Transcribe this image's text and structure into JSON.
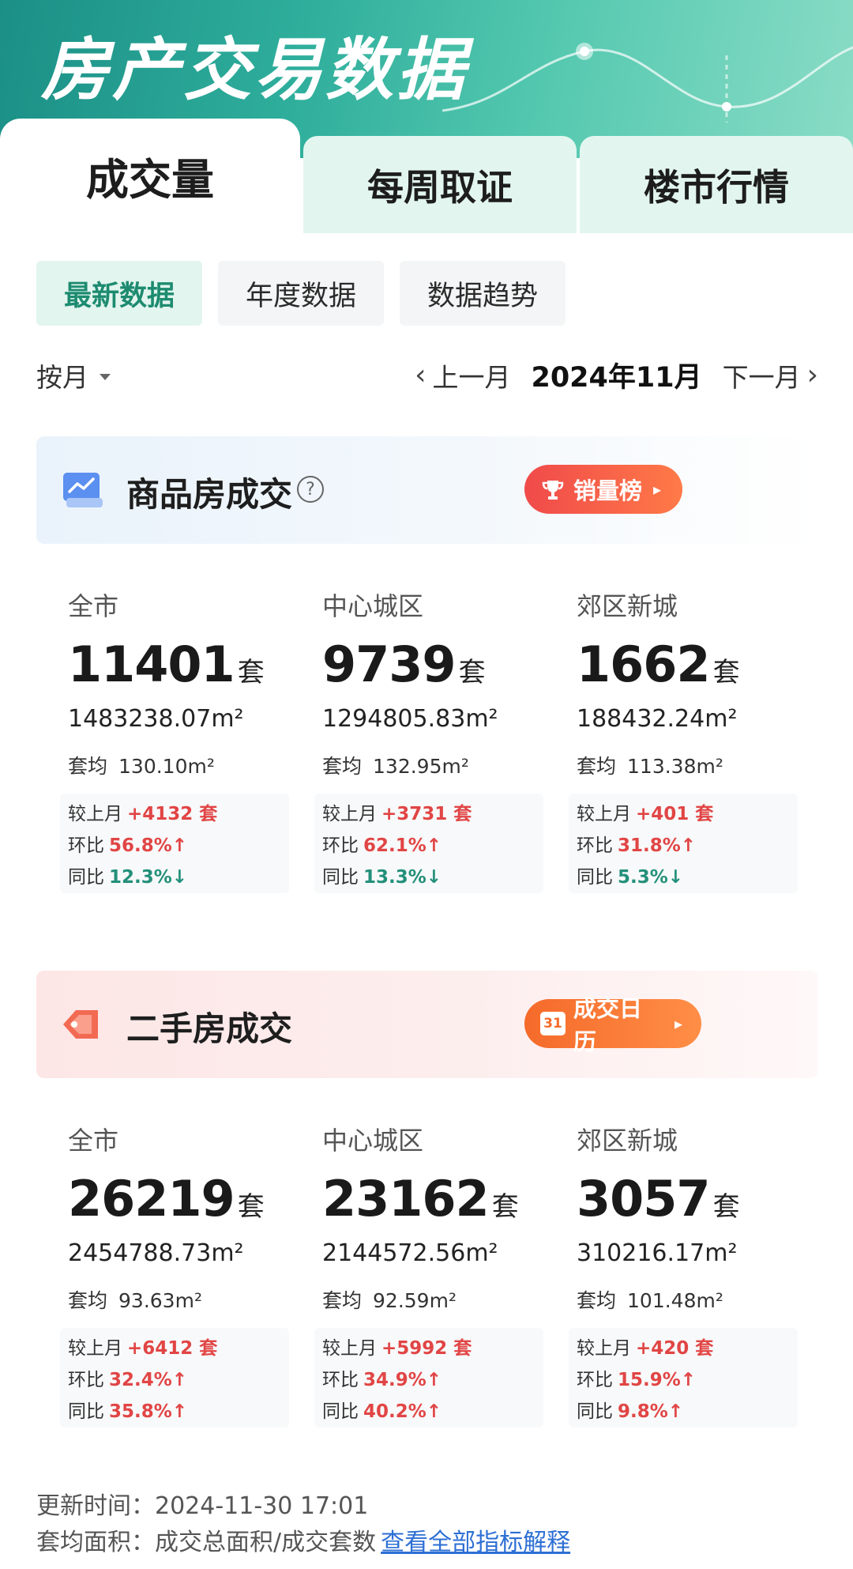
{
  "banner": {
    "title": "房产交易数据"
  },
  "main_tabs": [
    "成交量",
    "每周取证",
    "楼市行情"
  ],
  "sub_tabs": [
    "最新数据",
    "年度数据",
    "数据趋势"
  ],
  "month_bar": {
    "period": "按月",
    "prev_label": "上一月",
    "current_month": "2024年11月",
    "next_label": "下一月"
  },
  "new_homes": {
    "title": "商品房成交",
    "button_label": "销量榜",
    "columns": [
      {
        "region": "全市",
        "units": "11401",
        "unit_suffix": "套",
        "area": "1483238.07m²",
        "avg_key": "套均",
        "avg_value": "130.10m²",
        "mom_diff_key": "较上月",
        "mom_diff": "+4132 套",
        "mom_key": "环比",
        "mom": "56.8%↑",
        "yoy_key": "同比",
        "yoy": "12.3%↓"
      },
      {
        "region": "中心城区",
        "units": "9739",
        "unit_suffix": "套",
        "area": "1294805.83m²",
        "avg_key": "套均",
        "avg_value": "132.95m²",
        "mom_diff_key": "较上月",
        "mom_diff": "+3731 套",
        "mom_key": "环比",
        "mom": "62.1%↑",
        "yoy_key": "同比",
        "yoy": "13.3%↓"
      },
      {
        "region": "郊区新城",
        "units": "1662",
        "unit_suffix": "套",
        "area": "188432.24m²",
        "avg_key": "套均",
        "avg_value": "113.38m²",
        "mom_diff_key": "较上月",
        "mom_diff": "+401 套",
        "mom_key": "环比",
        "mom": "31.8%↑",
        "yoy_key": "同比",
        "yoy": "5.3%↓"
      }
    ]
  },
  "used_homes": {
    "title": "二手房成交",
    "button_calendar_day": "31",
    "button_label": "成交日历",
    "columns": [
      {
        "region": "全市",
        "units": "26219",
        "unit_suffix": "套",
        "area": "2454788.73m²",
        "avg_key": "套均",
        "avg_value": "93.63m²",
        "mom_diff_key": "较上月",
        "mom_diff": "+6412 套",
        "mom_key": "环比",
        "mom": "32.4%↑",
        "yoy_key": "同比",
        "yoy": "35.8%↑"
      },
      {
        "region": "中心城区",
        "units": "23162",
        "unit_suffix": "套",
        "area": "2144572.56m²",
        "avg_key": "套均",
        "avg_value": "92.59m²",
        "mom_diff_key": "较上月",
        "mom_diff": "+5992 套",
        "mom_key": "环比",
        "mom": "34.9%↑",
        "yoy_key": "同比",
        "yoy": "40.2%↑"
      },
      {
        "region": "郊区新城",
        "units": "3057",
        "unit_suffix": "套",
        "area": "310216.17m²",
        "avg_key": "套均",
        "avg_value": "101.48m²",
        "mom_diff_key": "较上月",
        "mom_diff": "+420 套",
        "mom_key": "环比",
        "mom": "15.9%↑",
        "yoy_key": "同比",
        "yoy": "9.8%↑"
      }
    ]
  },
  "footer": {
    "update_label": "更新时间：",
    "update_time": "2024-11-30 17:01",
    "formula_label": "套均面积：",
    "formula": "成交总面积/成交套数",
    "link_label": "查看全部指标解释"
  },
  "colors": {
    "up": "#e14545",
    "down": "#23907a",
    "accent": "#1d8b70",
    "link": "#2d6fd4"
  }
}
